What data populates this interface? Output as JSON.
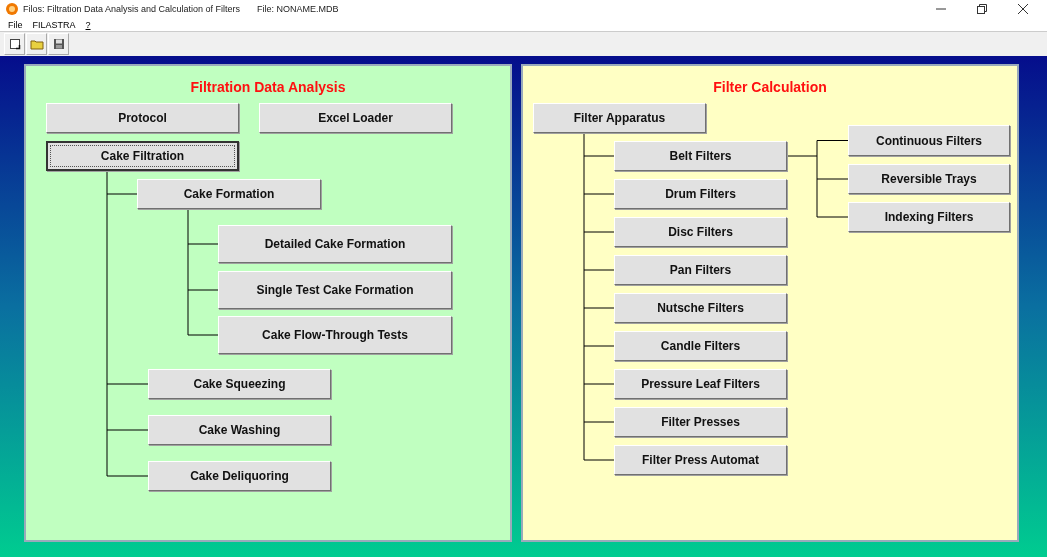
{
  "window": {
    "title": "Filos: Filtration Data Analysis and Calculation of Filters",
    "file": "File: NONAME.MDB"
  },
  "menu": [
    "File",
    "FILASTRA",
    "?"
  ],
  "panels": [
    {
      "kind": "analysis",
      "title": "Filtration Data Analysis",
      "top_buttons": [
        {
          "label": "Protocol",
          "focused": false
        },
        {
          "label": "Excel Loader",
          "focused": false
        }
      ],
      "tree": {
        "label": "Cake Filtration",
        "focused": true,
        "children": [
          {
            "label": "Cake Formation",
            "focused": false,
            "children": [
              {
                "label": "Detailed Cake Formation",
                "focused": false
              },
              {
                "label": "Single Test Cake Formation",
                "focused": false
              },
              {
                "label": "Cake Flow-Through Tests",
                "focused": false
              }
            ]
          },
          {
            "label": "Cake Squeezing",
            "focused": false
          },
          {
            "label": "Cake Washing",
            "focused": false
          },
          {
            "label": "Cake Deliquoring",
            "focused": false
          }
        ]
      }
    },
    {
      "kind": "calculation",
      "title": "Filter Calculation",
      "tree": {
        "label": "Filter Apparatus",
        "focused": false,
        "children": [
          {
            "label": "Belt Filters",
            "focused": false,
            "children": [
              {
                "label": "Continuous Filters",
                "focused": false
              },
              {
                "label": "Reversible Trays",
                "focused": false
              },
              {
                "label": "Indexing Filters",
                "focused": false
              }
            ]
          },
          {
            "label": "Drum Filters",
            "focused": false
          },
          {
            "label": "Disc Filters",
            "focused": false
          },
          {
            "label": "Pan Filters",
            "focused": false
          },
          {
            "label": "Nutsche Filters",
            "focused": false
          },
          {
            "label": "Candle Filters",
            "focused": false
          },
          {
            "label": "Pressure Leaf Filters",
            "focused": false
          },
          {
            "label": "Filter Presses",
            "focused": false
          },
          {
            "label": "Filter Press Automat",
            "focused": false
          }
        ]
      }
    }
  ]
}
